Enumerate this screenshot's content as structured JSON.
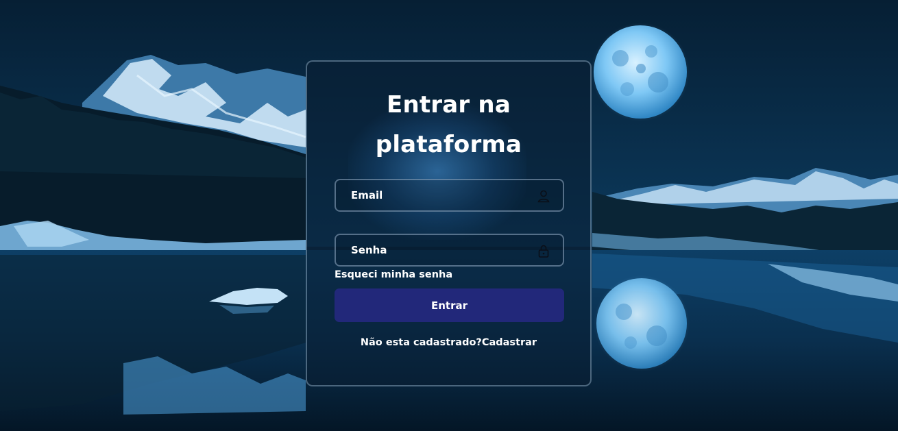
{
  "login": {
    "title_line1": "Entrar na",
    "title_line2": "plataforma",
    "email_placeholder": "Email",
    "email_icon": "user-icon",
    "password_placeholder": "Senha",
    "password_icon": "lock-icon",
    "forgot_label": "Esqueci minha senha",
    "submit_label": "Entrar",
    "signup_prompt": "Não esta cadastrado?",
    "signup_link": "Cadastrar"
  },
  "colors": {
    "button": "#22287a",
    "background": "#0b3556",
    "moon": "#7fc8f5",
    "text": "#ffffff"
  }
}
